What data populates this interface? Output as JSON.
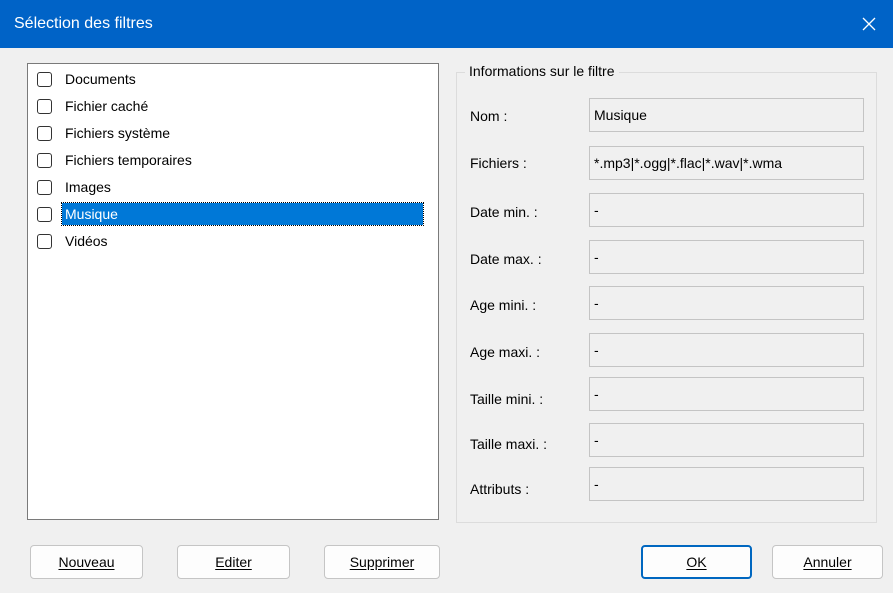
{
  "window": {
    "title": "Sélection des filtres"
  },
  "filter_list": [
    {
      "label": "Documents",
      "checked": false,
      "selected": false
    },
    {
      "label": "Fichier caché",
      "checked": false,
      "selected": false
    },
    {
      "label": "Fichiers système",
      "checked": false,
      "selected": false
    },
    {
      "label": "Fichiers temporaires",
      "checked": false,
      "selected": false
    },
    {
      "label": "Images",
      "checked": false,
      "selected": false
    },
    {
      "label": "Musique",
      "checked": false,
      "selected": true
    },
    {
      "label": "Vidéos",
      "checked": false,
      "selected": false
    }
  ],
  "info": {
    "group_title": "Informations sur le filtre",
    "fields": [
      {
        "label": "Nom :",
        "value": "Musique"
      },
      {
        "label": "Fichiers :",
        "value": "*.mp3|*.ogg|*.flac|*.wav|*.wma"
      },
      {
        "label": "Date min. :",
        "value": "-"
      },
      {
        "label": "Date max. :",
        "value": "-"
      },
      {
        "label": "Age mini. :",
        "value": "-"
      },
      {
        "label": "Age maxi. :",
        "value": "-"
      },
      {
        "label": "Taille mini. :",
        "value": "-"
      },
      {
        "label": "Taille maxi. :",
        "value": "-"
      },
      {
        "label": "Attributs :",
        "value": "-"
      }
    ]
  },
  "buttons": {
    "new": "Nouveau",
    "edit": "Editer",
    "delete": "Supprimer",
    "ok": "OK",
    "cancel": "Annuler"
  }
}
